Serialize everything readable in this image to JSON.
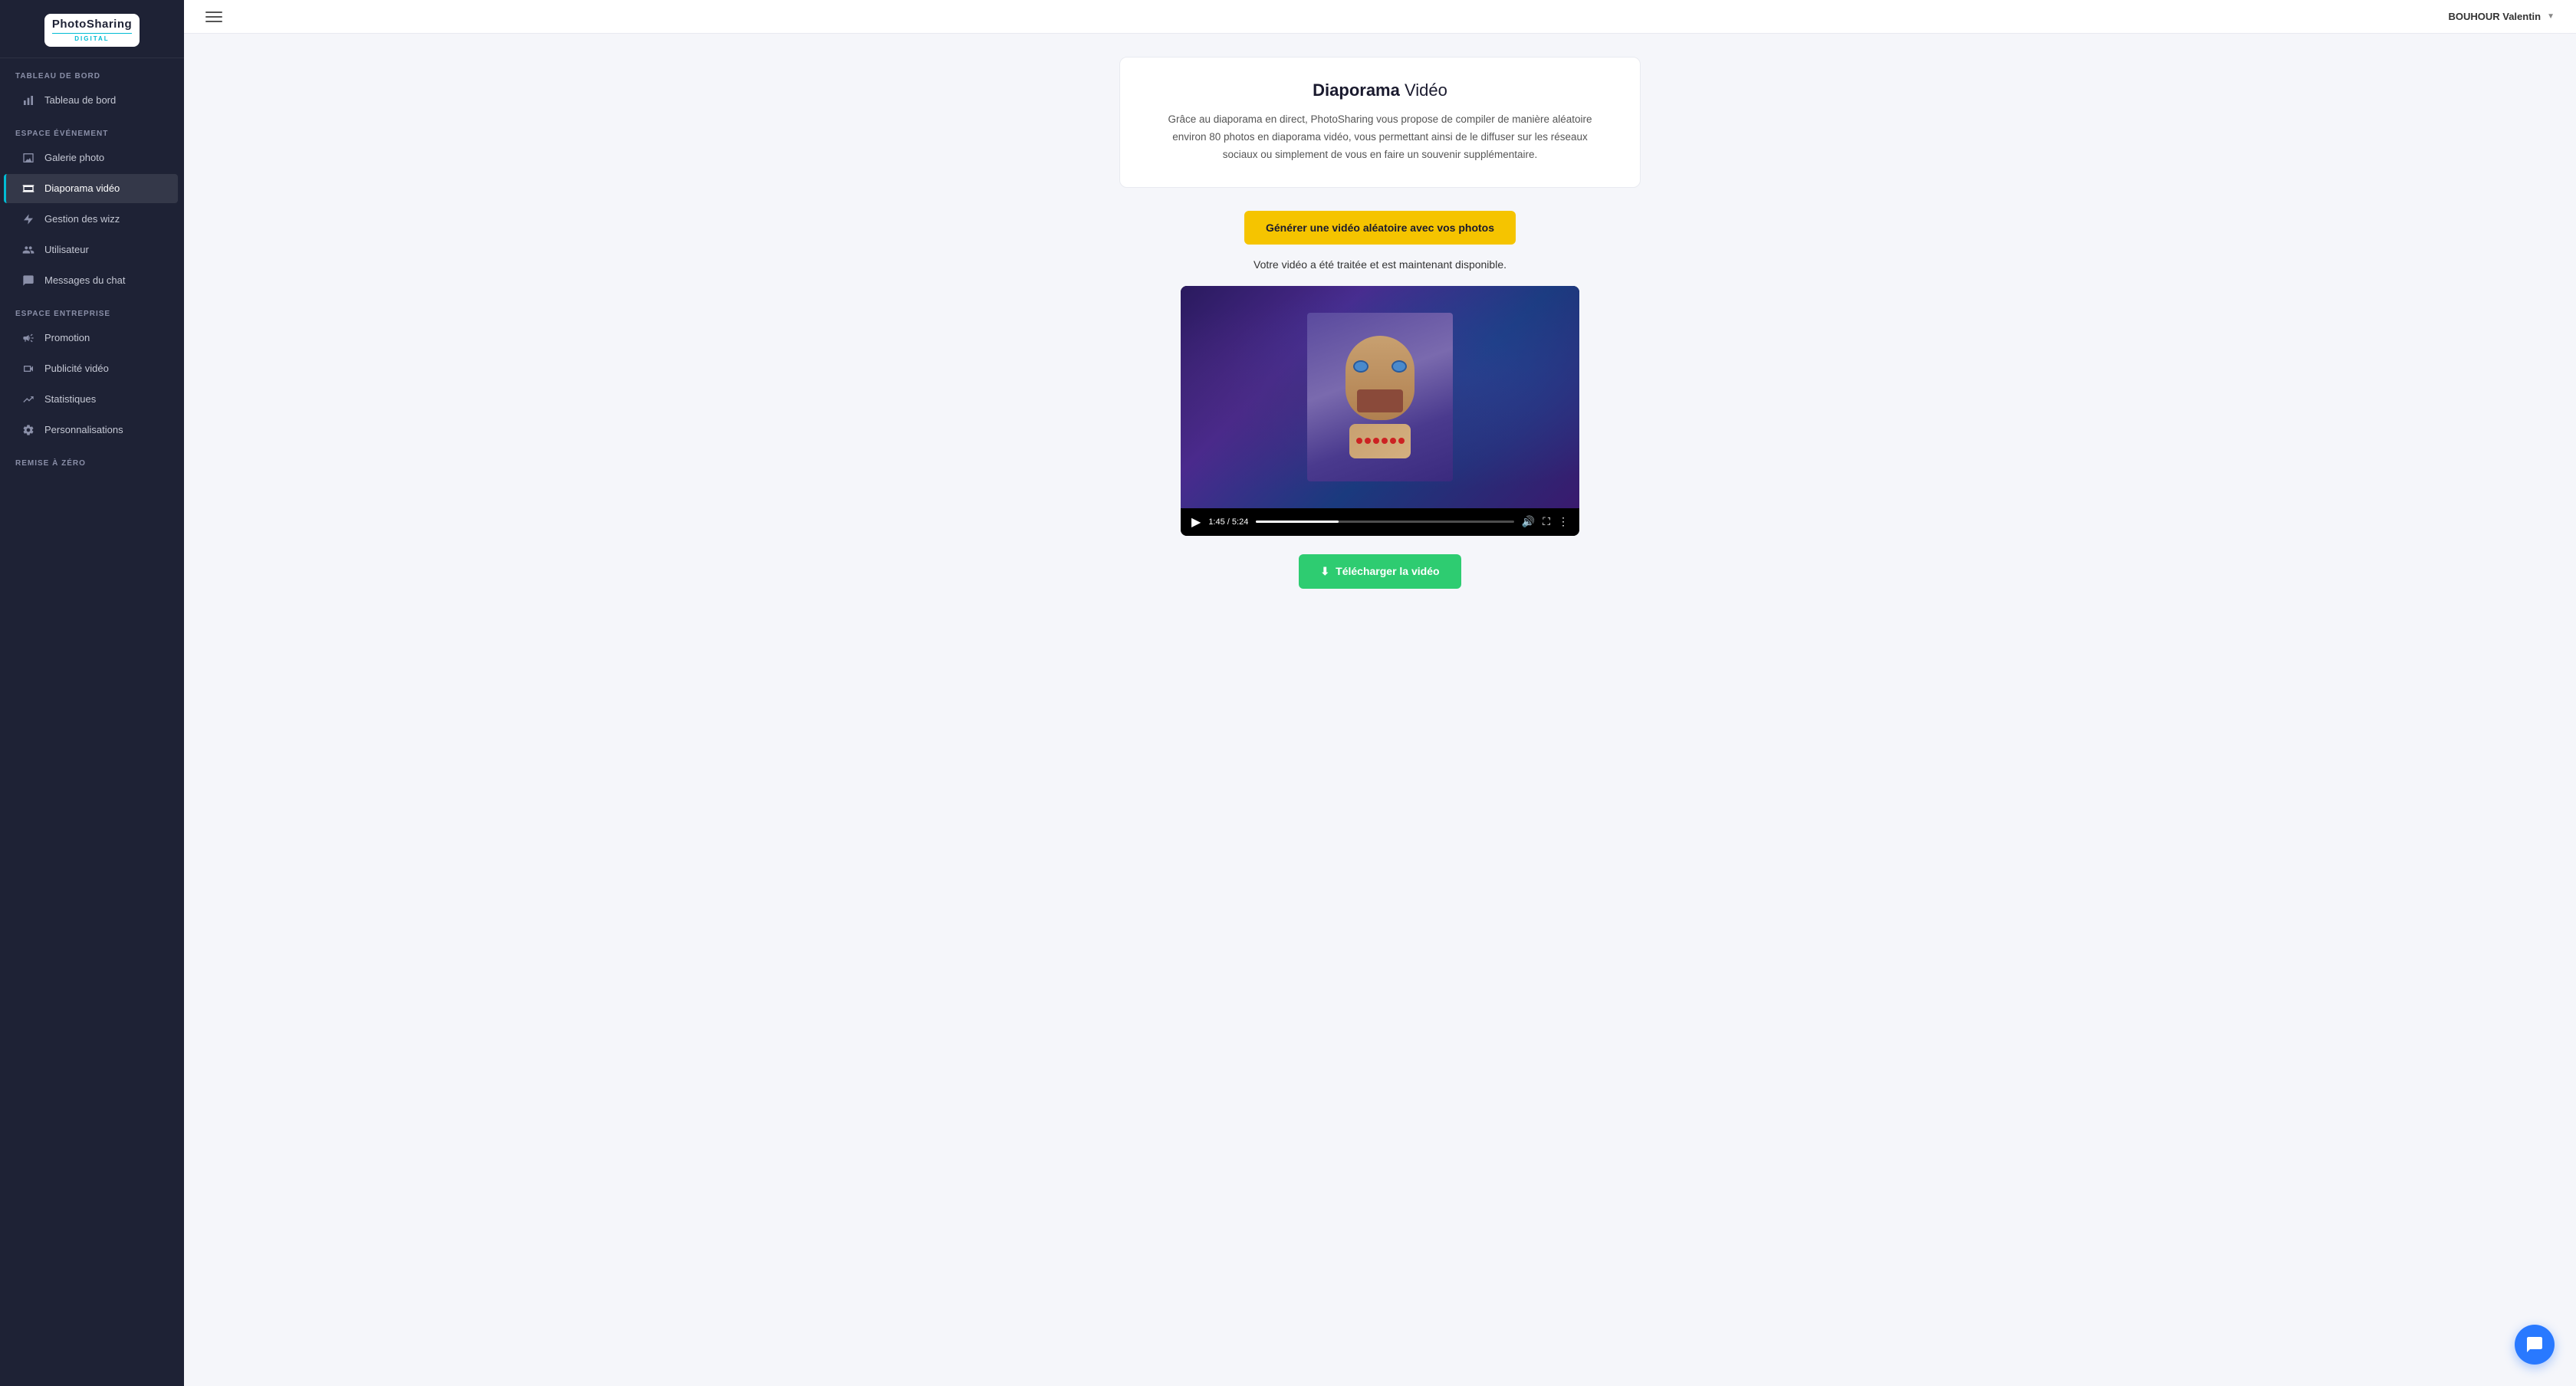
{
  "logo": {
    "main": "PhotoSharing",
    "sub": "Digital"
  },
  "sidebar": {
    "sections": [
      {
        "title": "TABLEAU DE BORD",
        "items": [
          {
            "id": "tableau-de-bord",
            "label": "Tableau de bord",
            "icon": "chart",
            "active": false
          }
        ]
      },
      {
        "title": "ESPACE ÉVÉNEMENT",
        "items": [
          {
            "id": "galerie-photo",
            "label": "Galerie photo",
            "icon": "image",
            "active": false
          },
          {
            "id": "diaporama-video",
            "label": "Diaporama vidéo",
            "icon": "slideshow",
            "active": true
          },
          {
            "id": "gestion-des-wizz",
            "label": "Gestion des wizz",
            "icon": "lightning",
            "active": false
          },
          {
            "id": "utilisateur",
            "label": "Utilisateur",
            "icon": "users",
            "active": false
          },
          {
            "id": "messages-du-chat",
            "label": "Messages du chat",
            "icon": "chat",
            "active": false
          }
        ]
      },
      {
        "title": "ESPACE ENTREPRISE",
        "items": [
          {
            "id": "promotion",
            "label": "Promotion",
            "icon": "megaphone",
            "active": false
          },
          {
            "id": "publicite-video",
            "label": "Publicité vidéo",
            "icon": "video",
            "active": false
          },
          {
            "id": "statistiques",
            "label": "Statistiques",
            "icon": "stats",
            "active": false
          },
          {
            "id": "personnalisations",
            "label": "Personnalisations",
            "icon": "gear",
            "active": false
          }
        ]
      },
      {
        "title": "REMISE À ZÉRO",
        "items": []
      }
    ]
  },
  "topbar": {
    "user_name": "BOUHOUR Valentin"
  },
  "main": {
    "card": {
      "title_bold": "Diaporama",
      "title_regular": " Vidéo",
      "description": "Grâce au diaporama en direct, PhotoSharing vous propose de compiler de manière aléatoire environ 80 photos en diaporama vidéo, vous permettant ainsi de le diffuser sur les réseaux sociaux ou simplement de vous en faire un souvenir supplémentaire."
    },
    "generate_button": "Générer une vidéo aléatoire avec vos photos",
    "status_text": "Votre vidéo a été traitée et est maintenant disponible.",
    "video": {
      "current_time": "1:45",
      "total_time": "5:24",
      "progress_percent": 32
    },
    "download_button": "Télécharger la vidéo"
  }
}
